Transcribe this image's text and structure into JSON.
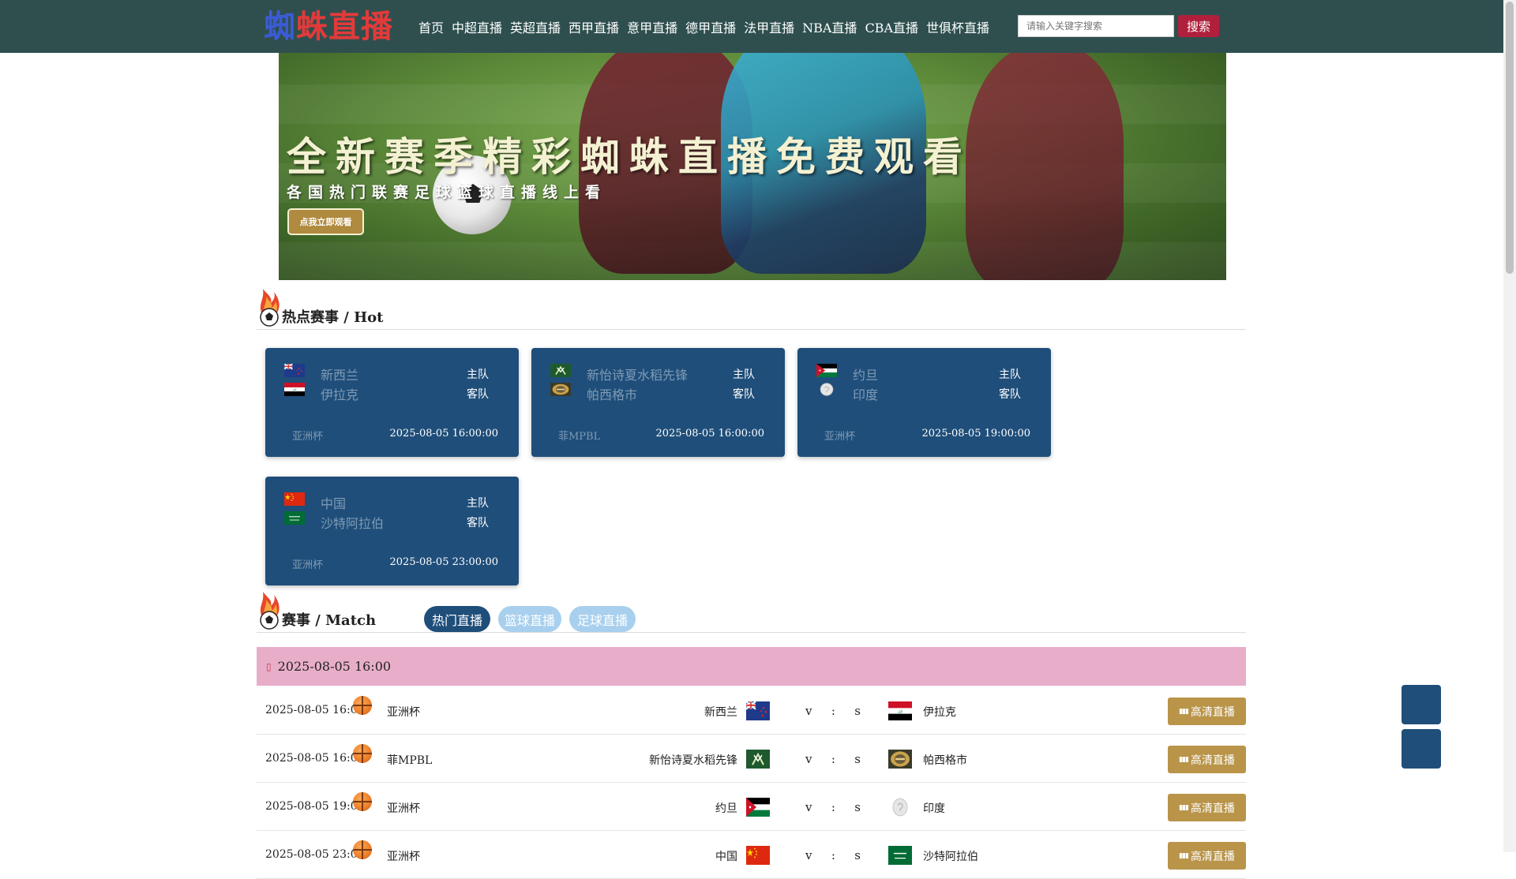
{
  "nav": {
    "logo": "蜘蛛直播",
    "items": [
      "首页",
      "中超直播",
      "英超直播",
      "西甲直播",
      "意甲直播",
      "德甲直播",
      "法甲直播",
      "NBA直播",
      "CBA直播",
      "世俱杯直播"
    ],
    "search_placeholder": "请输入关键字搜索",
    "search_button": "搜索"
  },
  "banner": {
    "title": "全新赛季精彩蜘蛛直播免费观看",
    "subtitle": "各国热门联赛足球篮球直播线上看",
    "button": "点我立即观看"
  },
  "hot": {
    "title": "热点赛事 / Hot",
    "home_label": "主队",
    "away_label": "客队",
    "cards": [
      {
        "home": "新西兰",
        "away": "伊拉克",
        "league": "亚洲杯",
        "time": "2025-08-05 16:00:00",
        "home_flag": "nz",
        "away_flag": "iq"
      },
      {
        "home": "新怡诗夏水稻先锋",
        "away": "帕西格市",
        "league": "菲MPBL",
        "time": "2025-08-05 16:00:00",
        "home_flag": "club-green",
        "away_flag": "club-gold"
      },
      {
        "home": "约旦",
        "away": "印度",
        "league": "亚洲杯",
        "time": "2025-08-05 19:00:00",
        "home_flag": "jo",
        "away_flag": "placeholder"
      },
      {
        "home": "中国",
        "away": "沙特阿拉伯",
        "league": "亚洲杯",
        "time": "2025-08-05 23:00:00",
        "home_flag": "cn",
        "away_flag": "sa"
      }
    ]
  },
  "match": {
    "title": "赛事 / Match",
    "tabs": [
      "热门直播",
      "篮球直播",
      "足球直播"
    ],
    "date_header": "2025-08-05 16:00",
    "vs": "v",
    "colon": ":",
    "s": "s",
    "live_label": "高清直播",
    "rows": [
      {
        "time": "2025-08-05 16:00",
        "league": "亚洲杯",
        "home": "新西兰",
        "away": "伊拉克",
        "home_flag": "nz",
        "away_flag": "iq"
      },
      {
        "time": "2025-08-05 16:00",
        "league": "菲MPBL",
        "home": "新怡诗夏水稻先锋",
        "away": "帕西格市",
        "home_flag": "club-green",
        "away_flag": "club-gold"
      },
      {
        "time": "2025-08-05 19:00",
        "league": "亚洲杯",
        "home": "约旦",
        "away": "印度",
        "home_flag": "jo",
        "away_flag": "placeholder"
      },
      {
        "time": "2025-08-05 23:00",
        "league": "亚洲杯",
        "home": "中国",
        "away": "沙特阿拉伯",
        "home_flag": "cn",
        "away_flag": "sa"
      }
    ]
  },
  "colors": {
    "navbar": "#2f4f4f",
    "card": "#1f4e7a",
    "date_bar": "#e8aec9",
    "live_button": "#b99449",
    "search_button": "#b0203c",
    "tab_active": "#1f4e7a",
    "tab_inactive": "#a8d0ee"
  }
}
